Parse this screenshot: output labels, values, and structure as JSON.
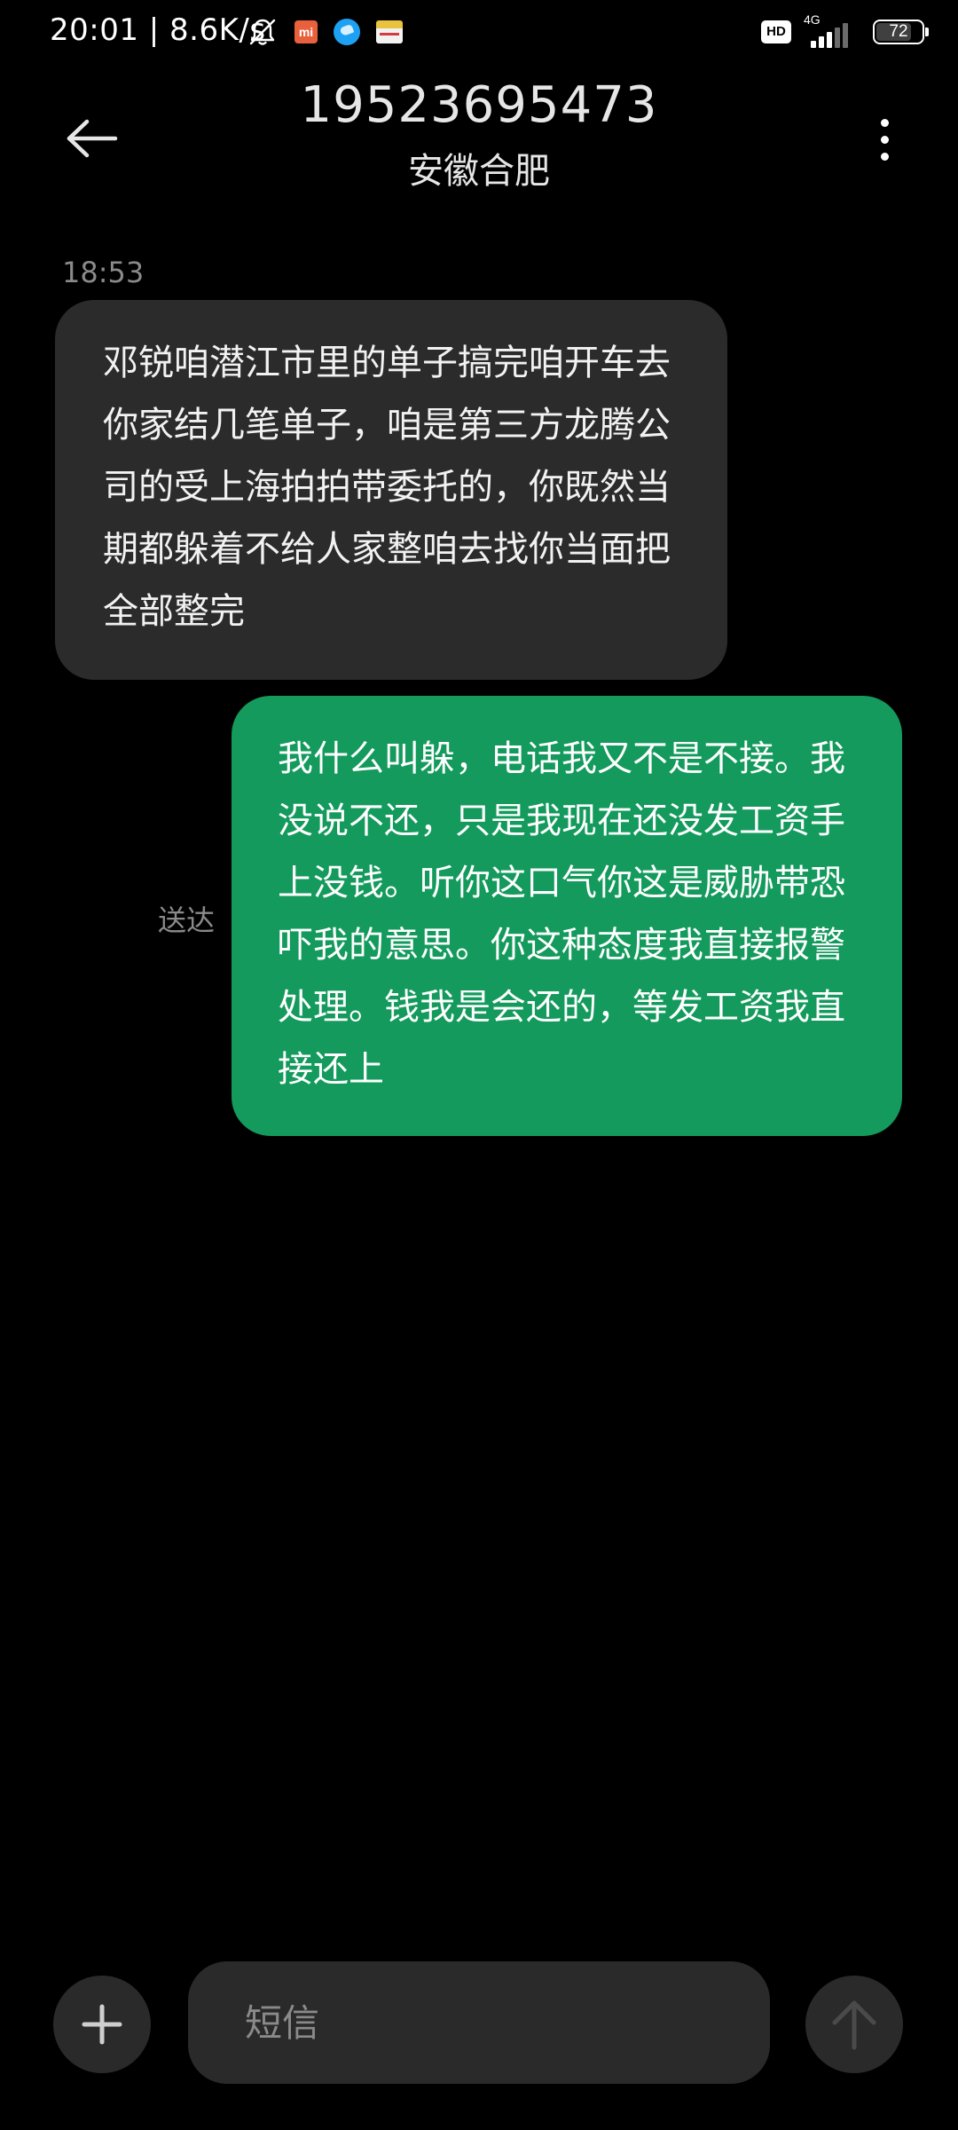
{
  "status_bar": {
    "time_speed": "20:01 | 8.6K/s",
    "mi_label": "mi",
    "hd_label": "HD",
    "network_type": "4G",
    "battery_level": "72",
    "icons": [
      "mute-bell-icon",
      "mi-app-icon",
      "bird-app-icon",
      "wallet-card-icon",
      "hd-voice-icon",
      "signal-icon",
      "battery-icon"
    ]
  },
  "header": {
    "phone_number": "19523695473",
    "location": "安徽合肥",
    "back_icon": "arrow-left-icon",
    "more_icon": "vertical-dots-icon"
  },
  "conversation": {
    "timestamp": "18:53",
    "messages": [
      {
        "direction": "incoming",
        "text": "邓锐咱潜江市里的单子搞完咱开车去你家结几笔单子，咱是第三方龙腾公司的受上海拍拍带委托的，你既然当期都躲着不给人家整咱去找你当面把全部整完"
      },
      {
        "direction": "outgoing",
        "text": "我什么叫躲，电话我又不是不接。我没说不还，只是我现在还没发工资手上没钱。听你这口气你这是威胁带恐吓我的意思。你这种态度我直接报警处理。钱我是会还的，等发工资我直接还上",
        "status": "送达"
      }
    ]
  },
  "composer": {
    "placeholder": "短信",
    "value": "",
    "add_icon": "plus-icon",
    "send_icon": "arrow-up-icon"
  },
  "colors": {
    "background": "#000000",
    "incoming_bubble": "#2b2b2b",
    "outgoing_bubble": "#139a5c",
    "secondary_text": "#8a8a8a",
    "control_bg": "#2a2a2a"
  }
}
